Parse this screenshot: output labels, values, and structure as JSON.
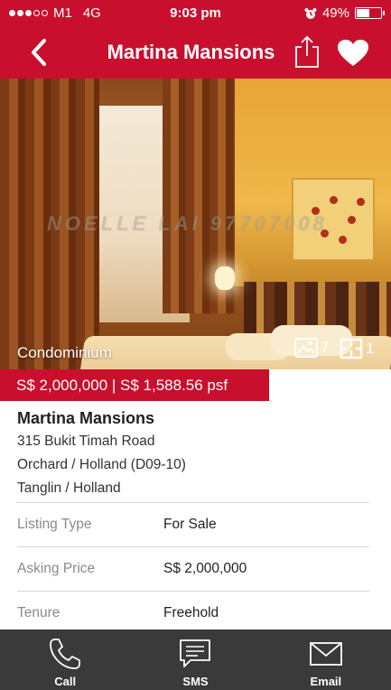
{
  "status_bar": {
    "carrier": "M1",
    "network": "4G",
    "time": "9:03 pm",
    "battery_percent": "49%",
    "battery_level": 0.49,
    "signal_bars_filled": 3,
    "signal_bars_total": 5
  },
  "nav": {
    "title": "Martina Mansions",
    "back_icon": "chevron-left-icon",
    "share_icon": "share-icon",
    "favorite_icon": "heart-icon"
  },
  "hero": {
    "property_type": "Condominium",
    "watermark": "NOELLE LAI 97707008",
    "photo_count": "7",
    "floorplan_count": "1"
  },
  "price": {
    "text": "S$ 2,000,000 | S$ 1,588.56 psf"
  },
  "details": {
    "name": "Martina Mansions",
    "address": "315 Bukit Timah Road",
    "district": "Orchard / Holland (D09-10)",
    "area": "Tanglin / Holland"
  },
  "info": [
    {
      "label": "Listing Type",
      "value": "For Sale"
    },
    {
      "label": "Asking Price",
      "value": "S$ 2,000,000"
    },
    {
      "label": "Tenure",
      "value": "Freehold"
    }
  ],
  "actions": {
    "call": "Call",
    "sms": "SMS",
    "email": "Email"
  },
  "colors": {
    "brand_red": "#c8102e",
    "action_bar": "#3a3a3a"
  }
}
